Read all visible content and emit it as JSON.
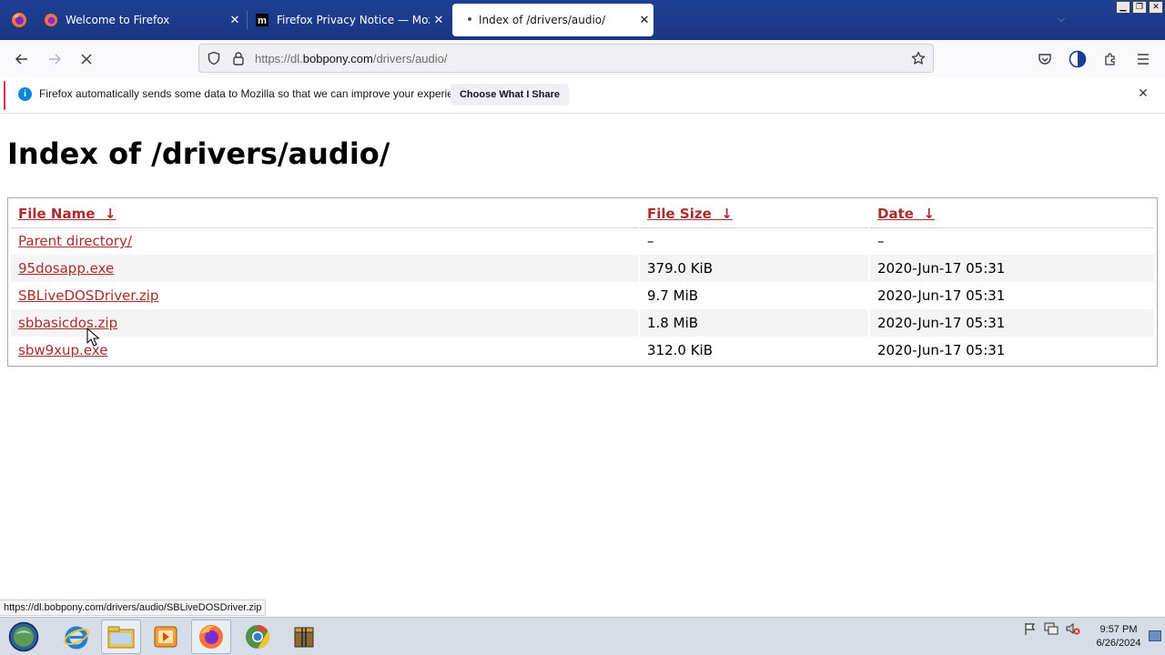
{
  "browser": {
    "tabs": [
      {
        "title": "Welcome to Firefox",
        "active": false
      },
      {
        "title": "Firefox Privacy Notice — Mozilla",
        "active": false
      },
      {
        "title": "Index of /drivers/audio/",
        "active": true
      }
    ],
    "url": {
      "prefix": "https://dl.",
      "host": "bobpony.com",
      "path": "/drivers/audio/"
    },
    "notification": {
      "message": "Firefox automatically sends some data to Mozilla so that we can improve your experience.",
      "button": "Choose What I Share"
    },
    "status_url": "https://dl.bobpony.com/drivers/audio/SBLiveDOSDriver.zip",
    "colors": {
      "tabstrip": "#1c3c8c",
      "link": "#a62e2e",
      "info": "#0b84e0",
      "notif_stripe": "#d7264f"
    }
  },
  "page": {
    "title": "Index of /drivers/audio/",
    "headers": {
      "name": "File Name",
      "size": "File Size",
      "date": "Date",
      "sort_arrow": "↓"
    },
    "rows": [
      {
        "name": "Parent directory/",
        "size": "–",
        "date": "–"
      },
      {
        "name": "95dosapp.exe",
        "size": "379.0 KiB",
        "date": "2020-Jun-17 05:31"
      },
      {
        "name": "SBLiveDOSDriver.zip",
        "size": "9.7 MiB",
        "date": "2020-Jun-17 05:31"
      },
      {
        "name": "sbbasicdos.zip",
        "size": "1.8 MiB",
        "date": "2020-Jun-17 05:31"
      },
      {
        "name": "sbw9xup.exe",
        "size": "312.0 KiB",
        "date": "2020-Jun-17 05:31"
      }
    ]
  },
  "taskbar": {
    "icons": [
      "start-orb-icon",
      "internet-explorer-icon",
      "file-explorer-icon",
      "media-player-icon",
      "firefox-icon",
      "chrome-icon",
      "archive-icon"
    ],
    "time": "9:57 PM",
    "date": "6/26/2024"
  }
}
